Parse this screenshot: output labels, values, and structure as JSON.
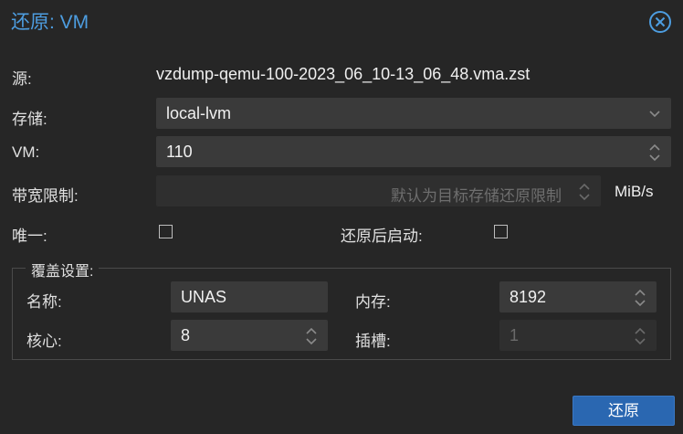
{
  "dialog": {
    "title": "还原: VM"
  },
  "source": {
    "label": "源:",
    "value": "vzdump-qemu-100-2023_06_10-13_06_48.vma.zst"
  },
  "storage": {
    "label": "存储:",
    "value": "local-lvm"
  },
  "vm": {
    "label": "VM:",
    "value": "110"
  },
  "bandwidth": {
    "label": "带宽限制:",
    "placeholder": "默认为目标存储还原限制",
    "unit": "MiB/s"
  },
  "unique": {
    "label": "唯一:",
    "checked": false
  },
  "start_after": {
    "label": "还原后启动:",
    "checked": false
  },
  "override": {
    "legend": "覆盖设置:",
    "name": {
      "label": "名称:",
      "value": "UNAS"
    },
    "memory": {
      "label": "内存:",
      "value": "8192"
    },
    "cores": {
      "label": "核心:",
      "value": "8"
    },
    "sockets": {
      "label": "插槽:",
      "value": "1"
    }
  },
  "buttons": {
    "restore": "还原"
  },
  "colors": {
    "accent": "#4d9de0",
    "button": "#2a67b1",
    "background": "#262626",
    "field": "#3a3a3a"
  }
}
